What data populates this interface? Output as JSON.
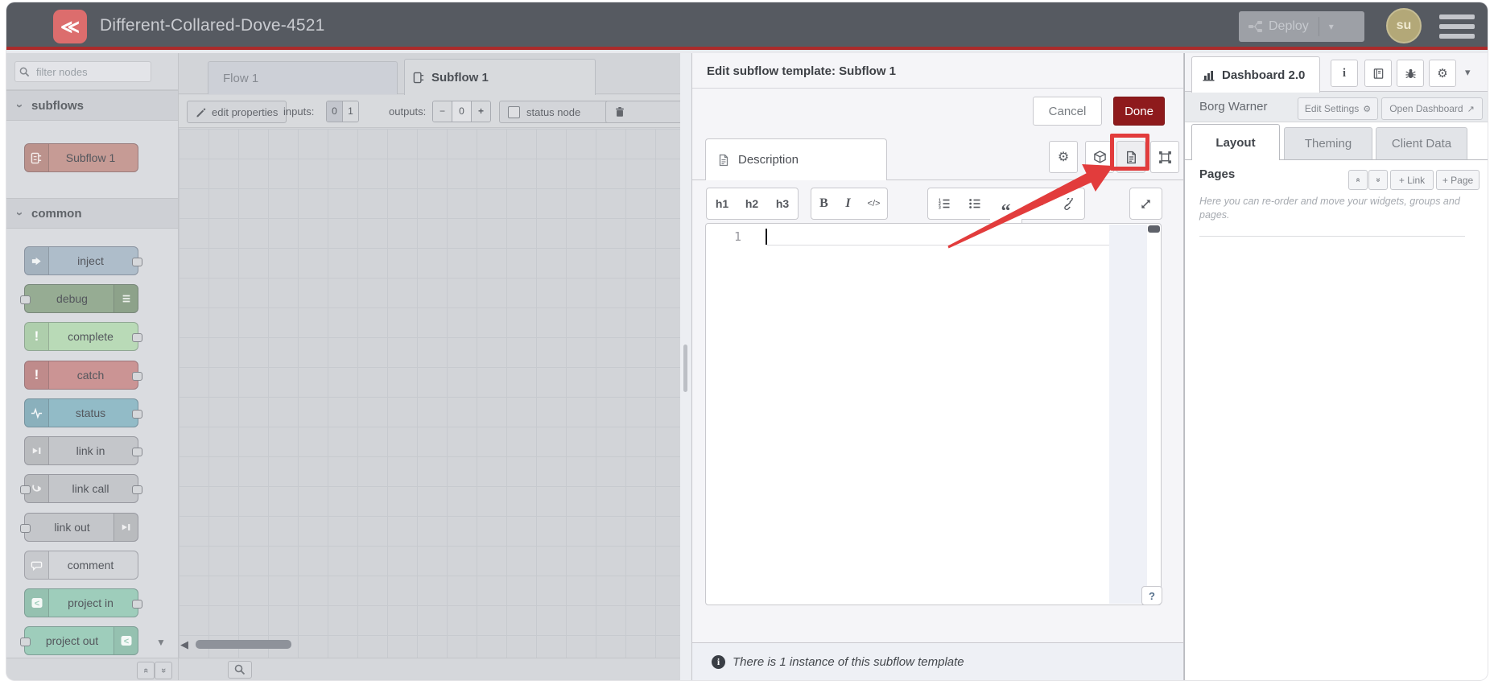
{
  "colors": {
    "header_bg": "#565a61",
    "accent_red": "#ab2b2b",
    "done_button": "#8e1a1c",
    "annotation": "#e23c3c",
    "avatar_bg": "#b3a878",
    "node_subflow": "#c69b95",
    "node_inject": "#aebdca",
    "node_debug": "#96ac93",
    "node_complete": "#b9dab7",
    "node_catch": "#cb9494",
    "node_status": "#92bbc7",
    "node_link": "#c4c6ca",
    "node_comment": "#d3d5d9",
    "node_project": "#9ecdbb"
  },
  "icons": {
    "logo_mark": "≪",
    "caret_down": "▾",
    "scroll_up": "▲",
    "scroll_down": "▼",
    "scroll_left": "◀",
    "chevron": "›",
    "collapse_up": "«",
    "collapse_down": "»",
    "gear": "⚙",
    "info": "i",
    "help": "?",
    "external": "↗"
  },
  "header": {
    "title": "Different-Collared-Dove-4521",
    "deploy_label": "Deploy",
    "avatar_initials": "su"
  },
  "palette": {
    "filter_placeholder": "filter nodes",
    "sections": [
      {
        "label": "subflows",
        "items": [
          {
            "label": "Subflow 1"
          }
        ]
      },
      {
        "label": "common",
        "items": [
          {
            "label": "inject"
          },
          {
            "label": "debug"
          },
          {
            "label": "complete"
          },
          {
            "label": "catch"
          },
          {
            "label": "status"
          },
          {
            "label": "link in"
          },
          {
            "label": "link call"
          },
          {
            "label": "link out"
          },
          {
            "label": "comment"
          },
          {
            "label": "project in"
          },
          {
            "label": "project out"
          }
        ]
      }
    ]
  },
  "workspace": {
    "tabs": [
      {
        "label": "Flow 1"
      },
      {
        "label": "Subflow 1"
      }
    ],
    "toolbar": {
      "edit_properties": "edit properties",
      "inputs_label": "inputs:",
      "input_options": [
        "0",
        "1"
      ],
      "selected_input": "0",
      "outputs_label": "outputs:",
      "output_minus": "−",
      "output_value": "0",
      "output_plus": "+",
      "status_node": "status node"
    }
  },
  "tray": {
    "title": "Edit subflow template: Subflow 1",
    "cancel": "Cancel",
    "done": "Done",
    "description_tab": "Description",
    "md_toolbar": {
      "h1": "h1",
      "h2": "h2",
      "h3": "h3",
      "bold": "B",
      "italic": "I",
      "code": "</>",
      "quote": "“",
      "hr": "—"
    },
    "editor": {
      "line_number": "1",
      "content": ""
    },
    "help_button": "?",
    "footer": "There is 1 instance of this subflow template"
  },
  "sidebar": {
    "tab_label": "Dashboard 2.0",
    "dashboard_name": "Borg Warner",
    "edit_settings": "Edit Settings",
    "open_dashboard": "Open Dashboard",
    "tabs": [
      {
        "label": "Layout"
      },
      {
        "label": "Theming"
      },
      {
        "label": "Client Data"
      }
    ],
    "pages": {
      "title": "Pages",
      "add_link": "+ Link",
      "add_page": "+ Page",
      "help": "Here you can re-order and move your widgets, groups and pages."
    }
  }
}
